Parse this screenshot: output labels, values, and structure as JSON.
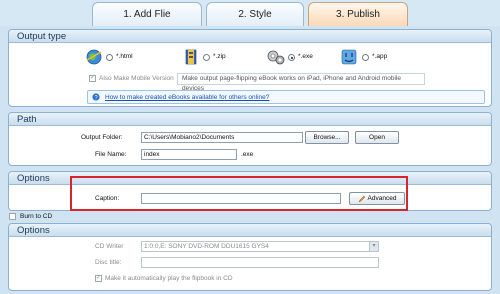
{
  "tabs": [
    {
      "label": "1. Add Flie"
    },
    {
      "label": "2. Style"
    },
    {
      "label": "3. Publish"
    }
  ],
  "output_type": {
    "title": "Output type",
    "options": [
      {
        "label": "*.html",
        "selected": false,
        "icon": "html-globe-icon"
      },
      {
        "label": "*.zip",
        "selected": false,
        "icon": "zip-archive-icon"
      },
      {
        "label": "*.exe",
        "selected": true,
        "icon": "exe-gears-icon"
      },
      {
        "label": "*.app",
        "selected": false,
        "icon": "mac-app-icon"
      }
    ],
    "mobile_checkbox_label": "Also Make Mobile Version",
    "mobile_note": "Make output page-flipping eBook works on iPad, iPhone and Android mobile devices",
    "help_link": "How to make created eBooks available for others online?"
  },
  "path": {
    "title": "Path",
    "output_folder_label": "Output Folder:",
    "output_folder_value": "C:\\Users\\Mobiano2\\Documents",
    "browse_label": "Browse...",
    "open_label": "Open",
    "file_name_label": "File Name:",
    "file_name_value": "index",
    "file_ext": ".exe"
  },
  "options1": {
    "title": "Options",
    "caption_label": "Caption:",
    "caption_value": "",
    "advanced_label": "Advanced"
  },
  "burn_to_cd_label": "Burn to CD",
  "options2": {
    "title": "Options",
    "cd_writer_label": "CD Writer",
    "cd_writer_value": "1:0:0,E: SONY    DVD-ROM DDU1615  GYS4",
    "disc_title_label": "Disc title:",
    "disc_title_value": "",
    "autoplay_label": "Make it automatically play the flipbook in CD"
  },
  "colors": {
    "highlight": "#d6252f",
    "active_tab": "#fad9b6"
  }
}
